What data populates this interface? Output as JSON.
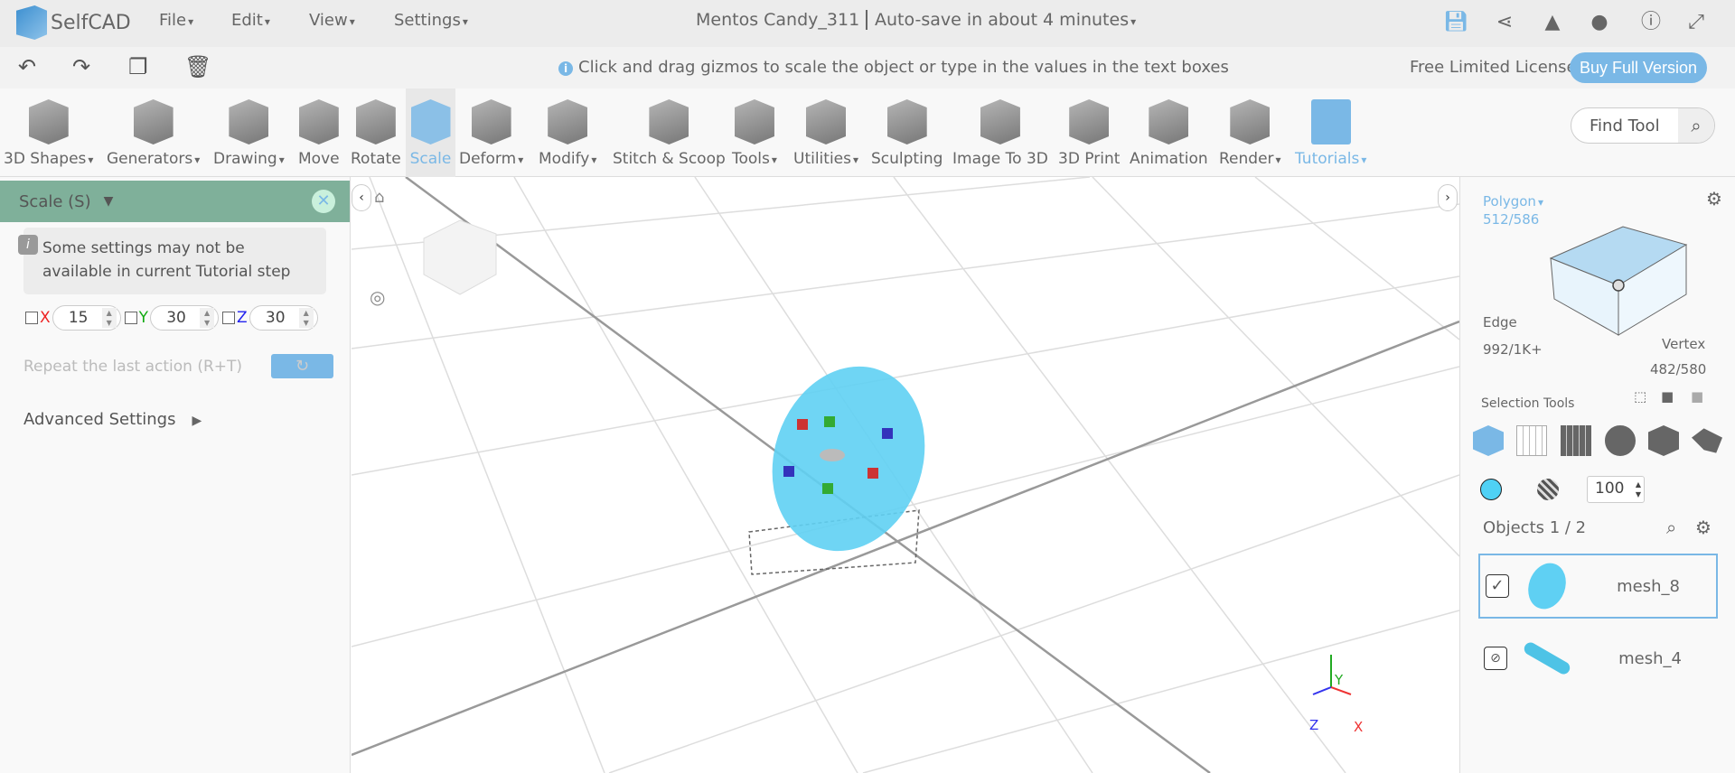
{
  "app": {
    "name": "SelfCAD",
    "document_title": "Mentos Candy_311",
    "autosave": "Auto-save in about 4 minutes"
  },
  "menu": [
    "File",
    "Edit",
    "View",
    "Settings"
  ],
  "top_icons": [
    "save-icon",
    "share-icon",
    "bell-icon",
    "user-icon",
    "info-icon",
    "fullscreen-icon"
  ],
  "hint": "Click and drag gizmos to scale the object or type in the values in the text boxes",
  "license": "Free Limited License",
  "buy": "Buy Full Version",
  "tools": [
    "3D Shapes",
    "Generators",
    "Drawing",
    "Move",
    "Rotate",
    "Scale",
    "Deform",
    "Modify",
    "Stitch & Scoop",
    "Tools",
    "Utilities",
    "Sculpting",
    "Image To 3D",
    "3D Print",
    "Animation",
    "Render",
    "Tutorials"
  ],
  "find_tool": "Find Tool",
  "panel": {
    "title": "Scale (S)",
    "info": "Some settings may not be available in current Tutorial step",
    "x_label": "X",
    "x": "15",
    "y_label": "Y",
    "y": "30",
    "z_label": "Z",
    "z": "30",
    "repeat": "Repeat the last action (R+T)",
    "advanced": "Advanced Settings"
  },
  "selection": {
    "polygon_label": "Polygon",
    "polygon_count": "512/586",
    "edge_label": "Edge",
    "edge_count": "992/1K+",
    "vertex_label": "Vertex",
    "vertex_count": "482/580",
    "tools_label": "Selection Tools",
    "opacity": "100"
  },
  "objects": {
    "label": "Objects 1 / 2",
    "items": [
      {
        "name": "mesh_8",
        "checked": true
      },
      {
        "name": "mesh_4",
        "hidden": true
      }
    ]
  },
  "axes": {
    "y": "Y",
    "x": "X",
    "z": "Z"
  },
  "colors": {
    "accent": "#7ab8e6",
    "panel_header": "#7fb09a",
    "object": "#4fd1f5"
  }
}
